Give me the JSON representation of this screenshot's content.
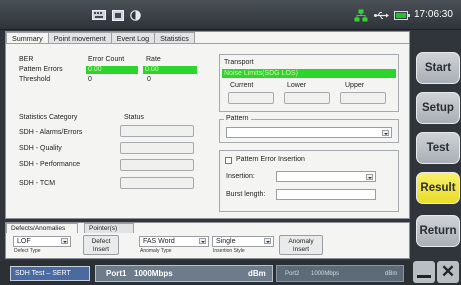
{
  "topbar": {
    "icons": [
      "keyboard-icon",
      "screenshot-icon",
      "contrast-icon",
      "network-icon",
      "usb-icon",
      "battery-icon"
    ],
    "clock": "17:06:30",
    "battery_color": "#22c02a",
    "network_color": "#37d23a"
  },
  "tabs": [
    "Summary",
    "Point movement",
    "Event Log",
    "Statistics"
  ],
  "ber": {
    "label": "BER",
    "col_error_count": "Error Count",
    "col_rate": "Rate",
    "pattern_errors_label": "Pattern Errors",
    "pattern_errors_count": "0.00",
    "pattern_errors_rate": "0.00",
    "threshold_label": "Threshold",
    "threshold_count": "0",
    "threshold_rate": "0"
  },
  "transport": {
    "title": "Transport",
    "status": "Noise Limits(SDG LOS)",
    "col_current": "Current",
    "col_lower": "Lower",
    "col_upper": "Upper"
  },
  "stats": {
    "category_label": "Statistics Category",
    "status_label": "Status",
    "items": [
      "SDH - Alarms/Errors",
      "SDH - Quality",
      "SDH - Performance",
      "SDH - TCM"
    ]
  },
  "pattern": {
    "title": "Pattern",
    "value": ""
  },
  "pattern_error": {
    "checkbox_label": "Pattern Error Insertion",
    "checked": false,
    "insertion_label": "Insertion:",
    "insertion_value": "",
    "burst_label": "Burst length:",
    "burst_value": ""
  },
  "defects": {
    "tabs": [
      "Defects/Anomalies",
      "Pointer(s)"
    ],
    "defect_value": "LOF",
    "defect_caption": "Defect Type",
    "defect_insert_label": "Defect Insert",
    "anomaly_value": "FAS Word",
    "anomaly_caption": "Anomaly Type",
    "insertion_style_value": "Single",
    "insertion_style_caption": "Insertion Style",
    "anomaly_insert_label": "Anomaly Insert"
  },
  "statusbar": {
    "test_label": "SDH Test – SERT",
    "port1_name": "Port1",
    "port1_rate": "1000Mbps",
    "port1_unit": "dBm",
    "port2_name": "Port2",
    "port2_rate": "1000Mbps",
    "port2_unit": "dBm"
  },
  "side_buttons": {
    "start": "Start",
    "setup": "Setup",
    "test": "Test",
    "result": "Result",
    "return": "Return",
    "active": "Result",
    "active_color": "#f2e845"
  },
  "window_buttons": {
    "close": "✕"
  }
}
